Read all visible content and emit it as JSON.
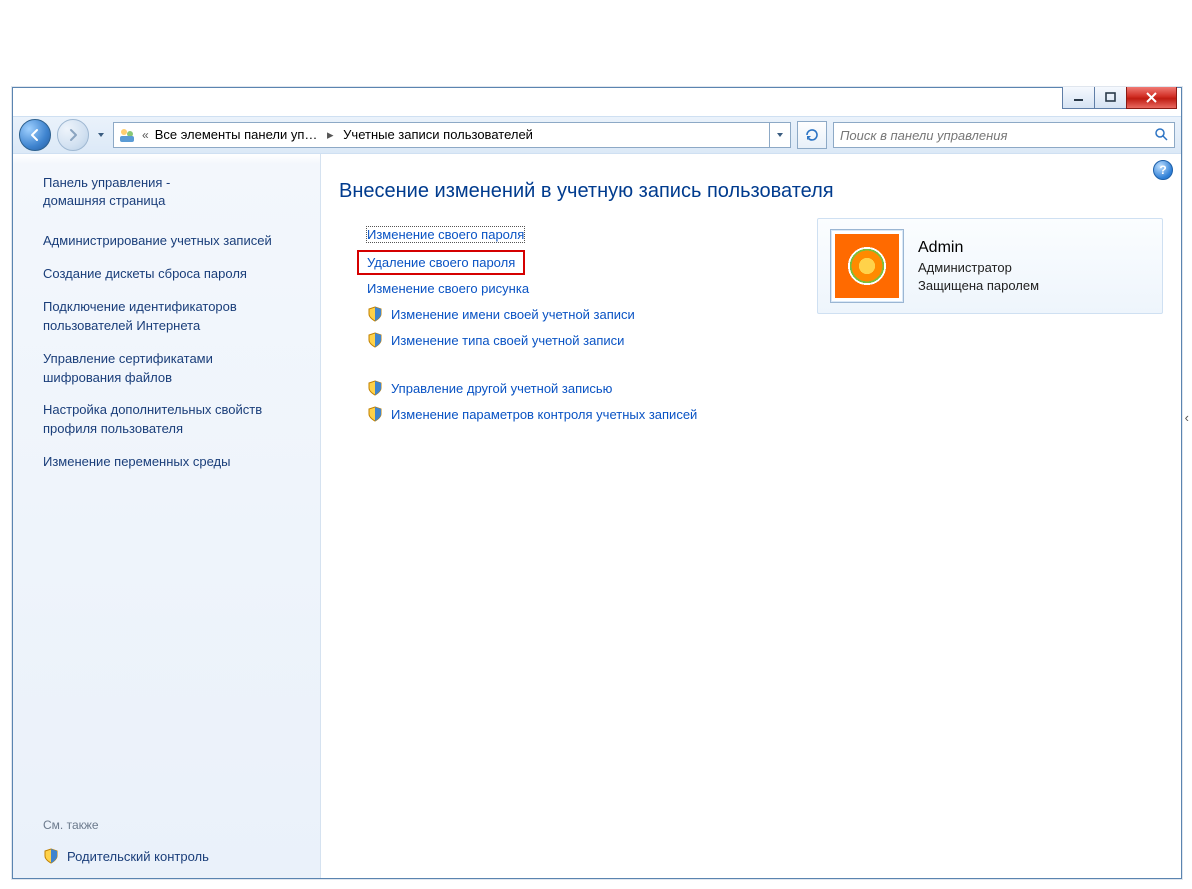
{
  "breadcrumb": {
    "parent": "Все элементы панели уп…",
    "current": "Учетные записи пользователей"
  },
  "search": {
    "placeholder": "Поиск в панели управления"
  },
  "sidebar": {
    "home_line1": "Панель управления -",
    "home_line2": "домашняя страница",
    "links": [
      "Администрирование учетных записей",
      "Создание дискеты сброса пароля",
      "Подключение идентификаторов пользователей Интернета",
      "Управление сертификатами шифрования файлов",
      "Настройка дополнительных свойств профиля пользователя",
      "Изменение переменных среды"
    ],
    "see_also": "См. также",
    "parental": "Родительский контроль"
  },
  "main": {
    "heading": "Внесение изменений в учетную запись пользователя",
    "tasks": [
      {
        "label": "Изменение своего пароля",
        "shield": false,
        "focus": true
      },
      {
        "label": "Удаление своего пароля",
        "shield": false,
        "redbox": true
      },
      {
        "label": "Изменение своего рисунка",
        "shield": false
      },
      {
        "label": "Изменение имени своей учетной записи",
        "shield": true
      },
      {
        "label": "Изменение типа своей учетной записи",
        "shield": true
      }
    ],
    "tasks2": [
      {
        "label": "Управление другой учетной записью",
        "shield": true
      },
      {
        "label": "Изменение параметров контроля учетных записей",
        "shield": true
      }
    ]
  },
  "account": {
    "name": "Admin",
    "role": "Администратор",
    "protected": "Защищена паролем"
  }
}
